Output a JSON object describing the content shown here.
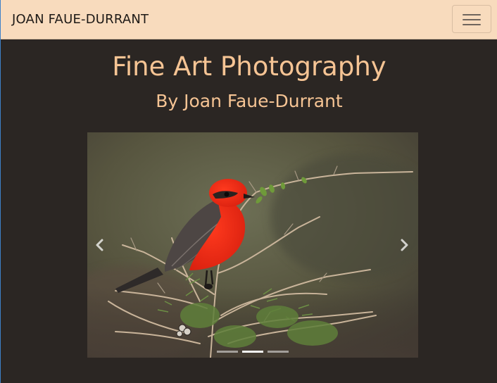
{
  "navbar": {
    "brand": "JOAN FAUE-DURRANT",
    "toggle_icon": "hamburger-menu-icon",
    "background": "#f8dbbd"
  },
  "header": {
    "title": "Fine Art Photography",
    "subtitle": "By Joan Faue-Durrant",
    "color": "#f6c494"
  },
  "carousel": {
    "image_subject": "red-bird-on-branch-photo",
    "prev_icon": "chevron-left-icon",
    "next_icon": "chevron-right-icon",
    "slide_count": 3,
    "active_slide": 2
  },
  "page": {
    "background": "#2b2623"
  }
}
